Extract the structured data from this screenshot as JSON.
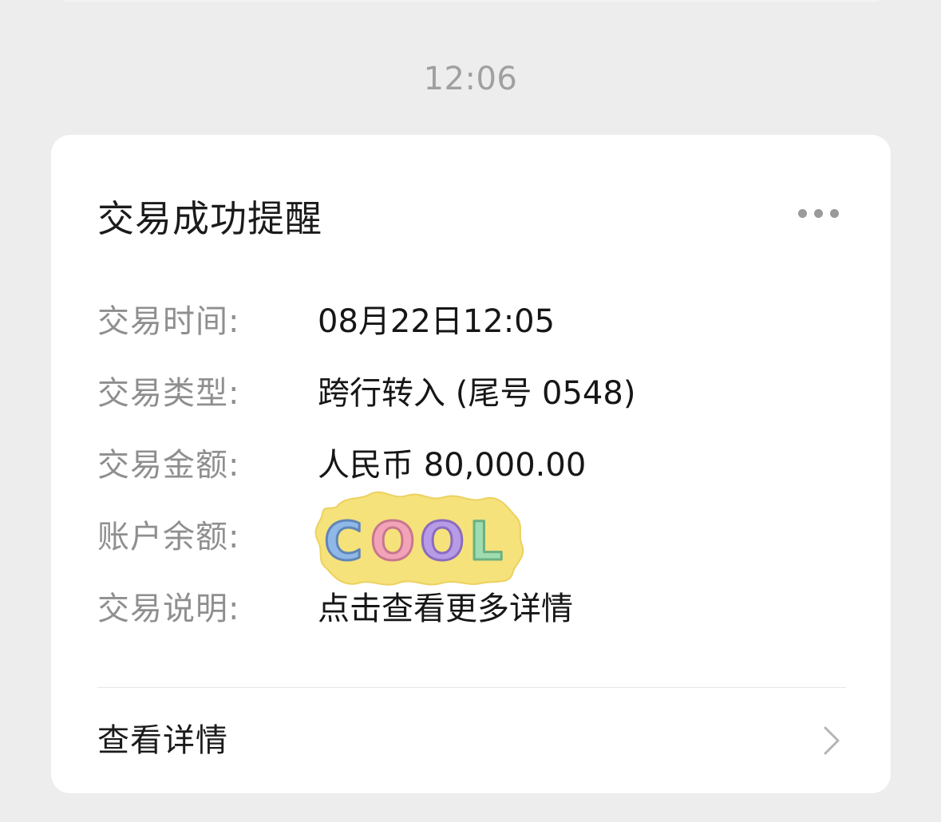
{
  "timestamp": "12:06",
  "card": {
    "title": "交易成功提醒",
    "more_icon": "more-dots-icon",
    "rows": [
      {
        "label": "交易时间:",
        "value": "08月22日12:05"
      },
      {
        "label": "交易类型:",
        "value": "跨行转入 (尾号 0548)"
      },
      {
        "label": "交易金额:",
        "value": "人民币 80,000.00"
      },
      {
        "label": "账户余额:",
        "value": ""
      },
      {
        "label": "交易说明:",
        "value": "点击查看更多详情"
      }
    ],
    "balance_cover_sticker": {
      "text": "COOL",
      "blob_color": "#f6e27a",
      "letter_colors": [
        "#8fb8e8",
        "#f2a3b8",
        "#b79be6",
        "#9fdcb0"
      ]
    },
    "details_link": {
      "label": "查看详情",
      "icon": "chevron-right-icon"
    }
  },
  "colors": {
    "background": "#ededed",
    "card": "#ffffff",
    "label": "#8f8f8f",
    "value": "#161616",
    "timestamp": "#a0a0a0"
  }
}
